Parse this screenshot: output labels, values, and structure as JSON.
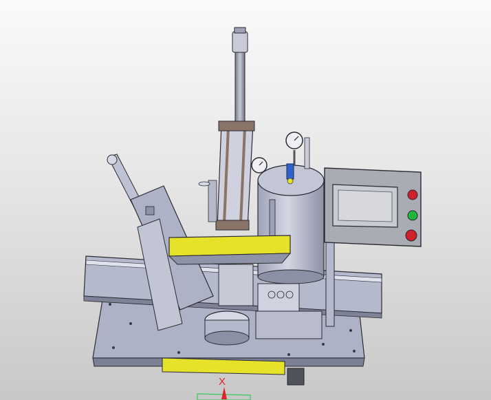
{
  "viewport": {
    "background_top": "#fafafa",
    "background_bottom": "#c8c8c8"
  },
  "model": {
    "colors": {
      "metal": "#b9bdd0",
      "metal_dark": "#8f93a8",
      "metal_light": "#d6d9e6",
      "yellow": "#e6e22a",
      "panel": "#a9acb3",
      "screen": "#c9cbd3",
      "button_red": "#d0202a",
      "button_green": "#1fb43a",
      "blue_valve": "#2d62c8",
      "cylinder_tan": "#8a7468"
    },
    "icons": [
      "pressure-gauge-icon",
      "control-panel-icon",
      "emergency-stop-icon"
    ]
  },
  "triad": {
    "x_label": "X",
    "x_color": "#e0202a",
    "plane_color": "#3cc85a"
  }
}
